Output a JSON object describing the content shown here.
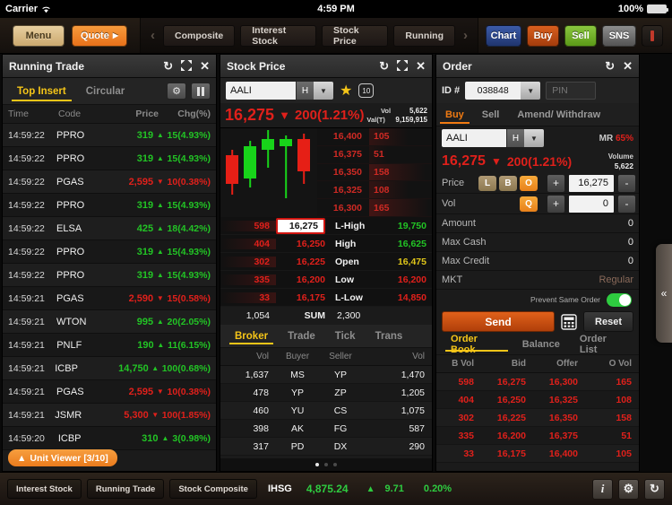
{
  "status_bar": {
    "carrier": "Carrier",
    "wifi_icon": "wifi-icon",
    "time": "4:59 PM",
    "battery": "100%"
  },
  "toolbar": {
    "menu_label": "Menu",
    "quote_label": "Quote",
    "quote_arrow": "▶",
    "prev_arrow": "‹",
    "next_arrow": "›",
    "tabs": [
      {
        "label": "Composite"
      },
      {
        "label": "Interest Stock"
      },
      {
        "label": "Stock Price"
      },
      {
        "label": "Running"
      }
    ],
    "chart_label": "Chart",
    "buy_label": "Buy",
    "sell_label": "Sell",
    "sns_label": "SNS"
  },
  "running_trade": {
    "title": "Running Trade",
    "refresh_icon": "↻",
    "expand_icon": "⤢",
    "close_icon": "✕",
    "tabs": [
      {
        "label": "Top Insert",
        "active": true
      },
      {
        "label": "Circular",
        "active": false
      }
    ],
    "gear_icon": "⚙",
    "pause_icon": "pause-icon",
    "columns": [
      "Time",
      "Code",
      "Price",
      "Chg(%)"
    ],
    "rows": [
      {
        "time": "14:59:22",
        "code": "PPRO",
        "price": "319",
        "dir": "up",
        "chg": "15(4.93%)"
      },
      {
        "time": "14:59:22",
        "code": "PPRO",
        "price": "319",
        "dir": "up",
        "chg": "15(4.93%)"
      },
      {
        "time": "14:59:22",
        "code": "PGAS",
        "price": "2,595",
        "dir": "down",
        "chg": "10(0.38%)"
      },
      {
        "time": "14:59:22",
        "code": "PPRO",
        "price": "319",
        "dir": "up",
        "chg": "15(4.93%)"
      },
      {
        "time": "14:59:22",
        "code": "ELSA",
        "price": "425",
        "dir": "up",
        "chg": "18(4.42%)"
      },
      {
        "time": "14:59:22",
        "code": "PPRO",
        "price": "319",
        "dir": "up",
        "chg": "15(4.93%)"
      },
      {
        "time": "14:59:22",
        "code": "PPRO",
        "price": "319",
        "dir": "up",
        "chg": "15(4.93%)"
      },
      {
        "time": "14:59:21",
        "code": "PGAS",
        "price": "2,590",
        "dir": "down",
        "chg": "15(0.58%)"
      },
      {
        "time": "14:59:21",
        "code": "WTON",
        "price": "995",
        "dir": "up",
        "chg": "20(2.05%)"
      },
      {
        "time": "14:59:21",
        "code": "PNLF",
        "price": "190",
        "dir": "up",
        "chg": "11(6.15%)"
      },
      {
        "time": "14:59:21",
        "code": "ICBP",
        "price": "14,750",
        "dir": "up",
        "chg": "100(0.68%)"
      },
      {
        "time": "14:59:21",
        "code": "PGAS",
        "price": "2,595",
        "dir": "down",
        "chg": "10(0.38%)"
      },
      {
        "time": "14:59:21",
        "code": "JSMR",
        "price": "5,300",
        "dir": "down",
        "chg": "100(1.85%)"
      },
      {
        "time": "14:59:20",
        "code": "ICBP",
        "price": "310",
        "dir": "up",
        "chg": "3(0.98%)"
      }
    ],
    "unit_viewer": {
      "arrow": "▲",
      "label": "Unit Viewer [3/10]"
    }
  },
  "stock_price": {
    "title": "Stock Price",
    "refresh_icon": "↻",
    "expand_icon": "⤢",
    "close_icon": "✕",
    "symbol": "AALI",
    "board": "H",
    "dropdown_icon": "▼",
    "star_icon": "★",
    "ten_icon": "10",
    "last_price": "16,275",
    "dir_icon": "▼",
    "change": "200(1.21%)",
    "vol_label": "Vol",
    "vol_value": "5,622",
    "val_label": "Val(T)",
    "val_value": "9,159,915",
    "mini_depth": [
      {
        "price": "16,400",
        "vol": "105",
        "fill": 0.62
      },
      {
        "price": "16,375",
        "vol": "51",
        "fill": 0.3
      },
      {
        "price": "16,350",
        "vol": "158",
        "fill": 0.9
      },
      {
        "price": "16,325",
        "vol": "108",
        "fill": 0.63
      },
      {
        "price": "16,300",
        "vol": "165",
        "fill": 0.95
      }
    ],
    "quote_rows": [
      {
        "vol": "598",
        "px": "16,275",
        "label": "L-High",
        "value": "19,750",
        "value_color": "#22c425",
        "highlight": true
      },
      {
        "vol": "404",
        "px": "16,250",
        "label": "High",
        "value": "16,625",
        "value_color": "#22c425",
        "highlight": false
      },
      {
        "vol": "302",
        "px": "16,225",
        "label": "Open",
        "value": "16,475",
        "value_color": "#e0c619",
        "highlight": false
      },
      {
        "vol": "335",
        "px": "16,200",
        "label": "Low",
        "value": "16,200",
        "value_color": "#e0201b",
        "highlight": false
      },
      {
        "vol": "33",
        "px": "16,175",
        "label": "L-Low",
        "value": "14,850",
        "value_color": "#e0201b",
        "highlight": false
      }
    ],
    "sum_row": {
      "vol": "1,054",
      "label": "SUM",
      "value": "2,300"
    },
    "tabs": [
      {
        "label": "Broker",
        "active": true
      },
      {
        "label": "Trade",
        "active": false
      },
      {
        "label": "Tick",
        "active": false
      },
      {
        "label": "Trans",
        "active": false
      }
    ],
    "broker_columns": [
      "Vol",
      "Buyer",
      "Seller",
      "Vol"
    ],
    "broker_rows": [
      {
        "bvol": "1,637",
        "buyer": "MS",
        "seller": "YP",
        "svol": "1,470"
      },
      {
        "bvol": "478",
        "buyer": "YP",
        "seller": "ZP",
        "svol": "1,205"
      },
      {
        "bvol": "460",
        "buyer": "YU",
        "seller": "CS",
        "svol": "1,075"
      },
      {
        "bvol": "398",
        "buyer": "AK",
        "seller": "FG",
        "svol": "587"
      },
      {
        "bvol": "317",
        "buyer": "PD",
        "seller": "DX",
        "svol": "290"
      }
    ],
    "page_dots": [
      true,
      false,
      false
    ],
    "candles": [
      {
        "open": 30,
        "close": 62,
        "high": 24,
        "low": 74,
        "up": false
      },
      {
        "open": 56,
        "close": 20,
        "high": 14,
        "low": 66,
        "up": true
      },
      {
        "open": 24,
        "close": 12,
        "high": 2,
        "low": 44,
        "up": true
      },
      {
        "open": 20,
        "close": 12,
        "high": 8,
        "low": 78,
        "up": true
      },
      {
        "open": 12,
        "close": 48,
        "high": 6,
        "low": 62,
        "up": false
      }
    ]
  },
  "order": {
    "title": "Order",
    "refresh_icon": "↻",
    "close_icon": "✕",
    "id_label": "ID #",
    "id_value": "038848",
    "dropdown_icon": "▼",
    "pin_placeholder": "PIN",
    "tabs": [
      {
        "label": "Buy",
        "active": true
      },
      {
        "label": "Sell",
        "active": false
      },
      {
        "label": "Amend/ Withdraw",
        "active": false
      }
    ],
    "symbol": "AALI",
    "board": "H",
    "mr_label": "MR",
    "mr_value": "65%",
    "last_price": "16,275",
    "dir_icon": "▼",
    "change": "200(1.21%)",
    "volume_label": "Volume",
    "volume_value": "5,622",
    "price_label": "Price",
    "price_modes": [
      {
        "label": "L",
        "on": false
      },
      {
        "label": "B",
        "on": false
      },
      {
        "label": "O",
        "on": true
      }
    ],
    "price_value": "16,275",
    "vol_label": "Vol",
    "vol_modes": [
      {
        "label": "Q",
        "on": true
      }
    ],
    "vol_value": "0",
    "plus_icon": "+",
    "minus_icon": "-",
    "info_rows": [
      {
        "key": "Amount",
        "value": "0",
        "muted": false
      },
      {
        "key": "Max Cash",
        "value": "0",
        "muted": false
      },
      {
        "key": "Max Credit",
        "value": "0",
        "muted": false
      },
      {
        "key": "MKT",
        "value": "Regular",
        "muted": true
      }
    ],
    "prevent_label": "Prevent Same Order",
    "prevent_on": true,
    "send_label": "Send",
    "calculator_icon": "calculator-icon",
    "reset_label": "Reset",
    "book_tabs": [
      {
        "label": "Order Book",
        "active": true
      },
      {
        "label": "Balance",
        "active": false
      },
      {
        "label": "Order List",
        "active": false
      }
    ],
    "book_columns": [
      "B Vol",
      "Bid",
      "Offer",
      "O Vol"
    ],
    "book_rows": [
      {
        "bvol": "598",
        "bid": "16,275",
        "offer": "16,300",
        "ovol": "165"
      },
      {
        "bvol": "404",
        "bid": "16,250",
        "offer": "16,325",
        "ovol": "108"
      },
      {
        "bvol": "302",
        "bid": "16,225",
        "offer": "16,350",
        "ovol": "158"
      },
      {
        "bvol": "335",
        "bid": "16,200",
        "offer": "16,375",
        "ovol": "51"
      },
      {
        "bvol": "33",
        "bid": "16,175",
        "offer": "16,400",
        "ovol": "105"
      }
    ]
  },
  "drawer": {
    "icon": "«"
  },
  "bottom_bar": {
    "pills": [
      {
        "label": "Interest Stock"
      },
      {
        "label": "Running Trade"
      },
      {
        "label": "Stock Composite"
      }
    ],
    "index_label": "IHSG",
    "index_value": "4,875.24",
    "index_arrow": "▲",
    "index_change": "9.71",
    "index_percent": "0.20%",
    "info_icon": "i",
    "settings_icon": "⚙",
    "refresh_icon": "↻"
  }
}
